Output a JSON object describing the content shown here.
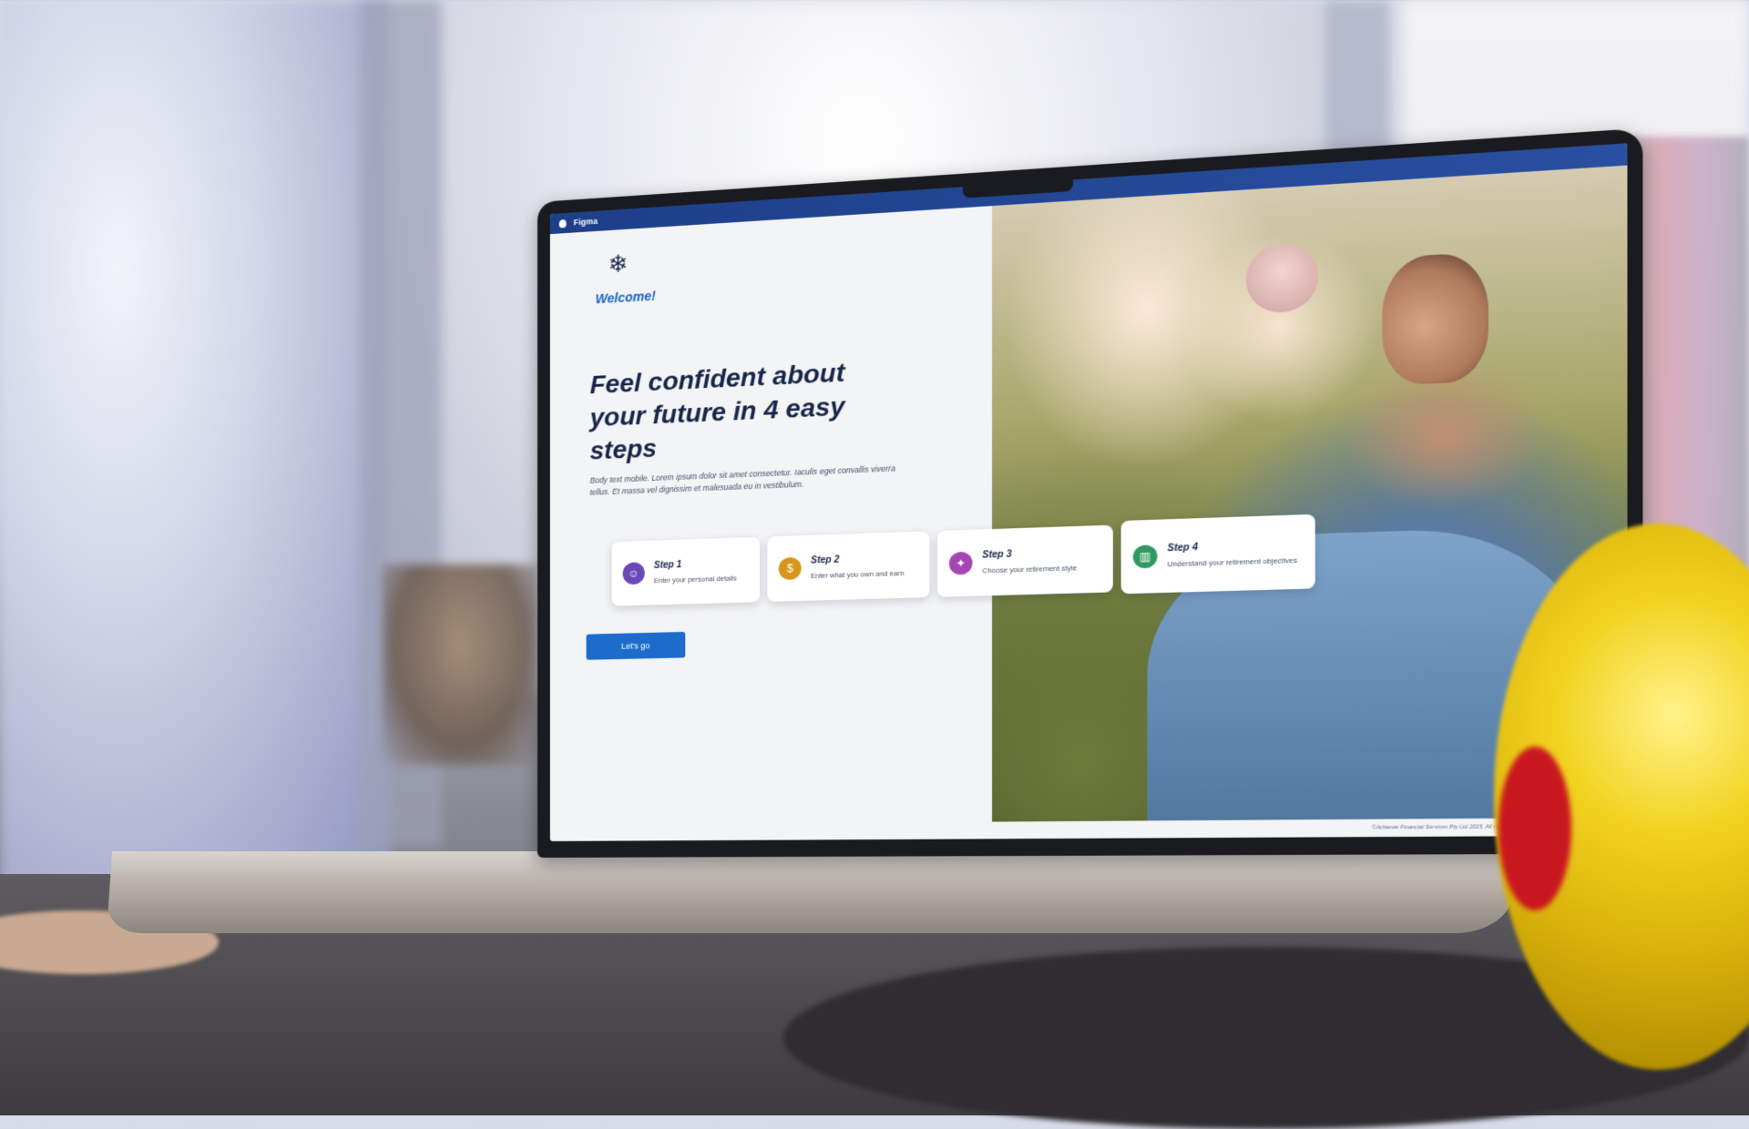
{
  "scene": {
    "lamp_color": "#f2d21f",
    "desk_color": "#3e3b3f"
  },
  "menubar": {
    "app_name": "Figma",
    "apple_icon": "apple-logo-icon",
    "background": "#1d3f8a"
  },
  "page": {
    "logo_icon": "snowflake-logo-icon",
    "welcome": "Welcome!",
    "headline": "Feel confident about your future in 4 easy steps",
    "body_copy": "Body text mobile. Lorem ipsum dolor sit amet consectetur. Iaculis eget convallis viverra tellus. Et massa vel dignissim et malesuada eu in vestibulum.",
    "cta_label": "Let's go",
    "accent_color": "#1d6ccc",
    "headline_color": "#17264a"
  },
  "steps": [
    {
      "title": "Step 1",
      "description": "Enter your personal details",
      "icon": "person-icon",
      "color": "#6a48b8"
    },
    {
      "title": "Step 2",
      "description": "Enter what you own and earn",
      "icon": "money-hand-icon",
      "color": "#d7961a"
    },
    {
      "title": "Step 3",
      "description": "Choose your retirement style",
      "icon": "lifestyle-icon",
      "color": "#a646b3"
    },
    {
      "title": "Step 4",
      "description": "Understand your retirement objectives",
      "icon": "chart-growth-icon",
      "color": "#2e9a62"
    }
  ],
  "footer": {
    "copyright": "©Achiever Financial Services Pty Ltd 2023. All rights reserved.",
    "logo_icon": "snowflake-logo-icon"
  }
}
